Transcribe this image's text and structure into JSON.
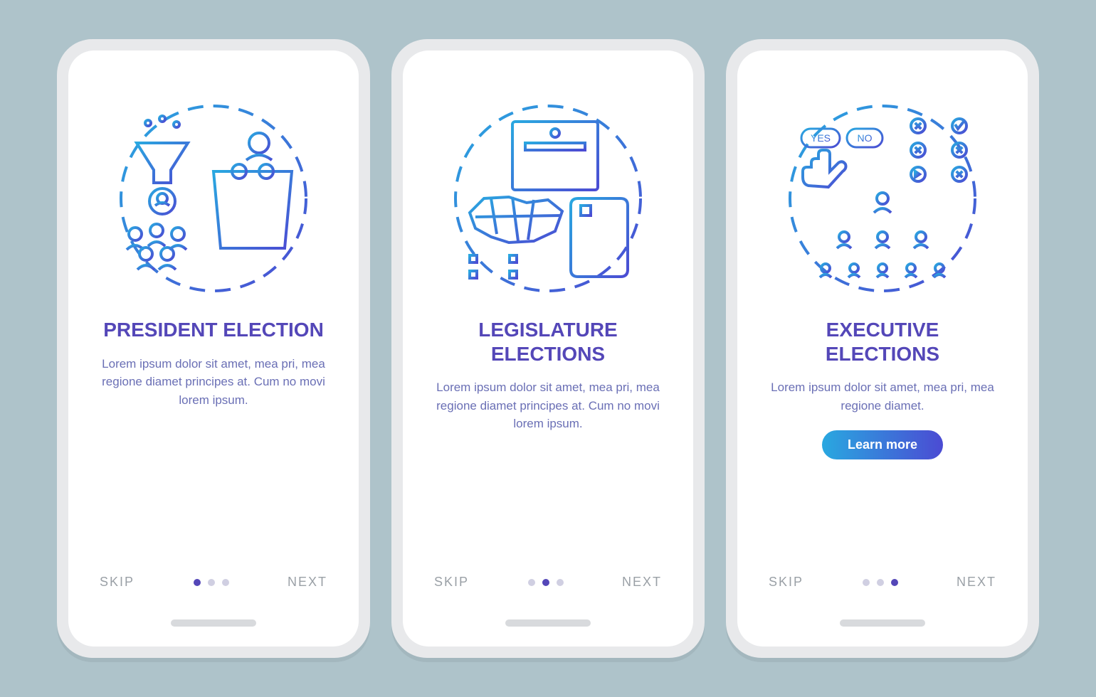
{
  "screens": [
    {
      "title": "President election",
      "desc": "Lorem ipsum dolor sit amet, mea pri, mea regione diamet principes at. Cum no movi lorem ipsum.",
      "skip": "SKIP",
      "next": "NEXT",
      "active_dot": 0,
      "has_cta": false
    },
    {
      "title": "Legislature\nelections",
      "desc": "Lorem ipsum dolor sit amet, mea pri, mea regione diamet principes at. Cum no movi lorem ipsum.",
      "skip": "SKIP",
      "next": "NEXT",
      "active_dot": 1,
      "has_cta": false
    },
    {
      "title": "Executive\nelections",
      "desc": "Lorem ipsum dolor sit amet, mea pri, mea regione diamet.",
      "skip": "SKIP",
      "next": "NEXT",
      "active_dot": 2,
      "has_cta": true,
      "cta": "Learn more"
    }
  ],
  "badges": {
    "yes": "YES",
    "no": "NO"
  },
  "colors": {
    "accent": "#5447b8",
    "cyan": "#29a8e0",
    "indigo": "#4b4bd3",
    "bg": "#aec3ca"
  }
}
